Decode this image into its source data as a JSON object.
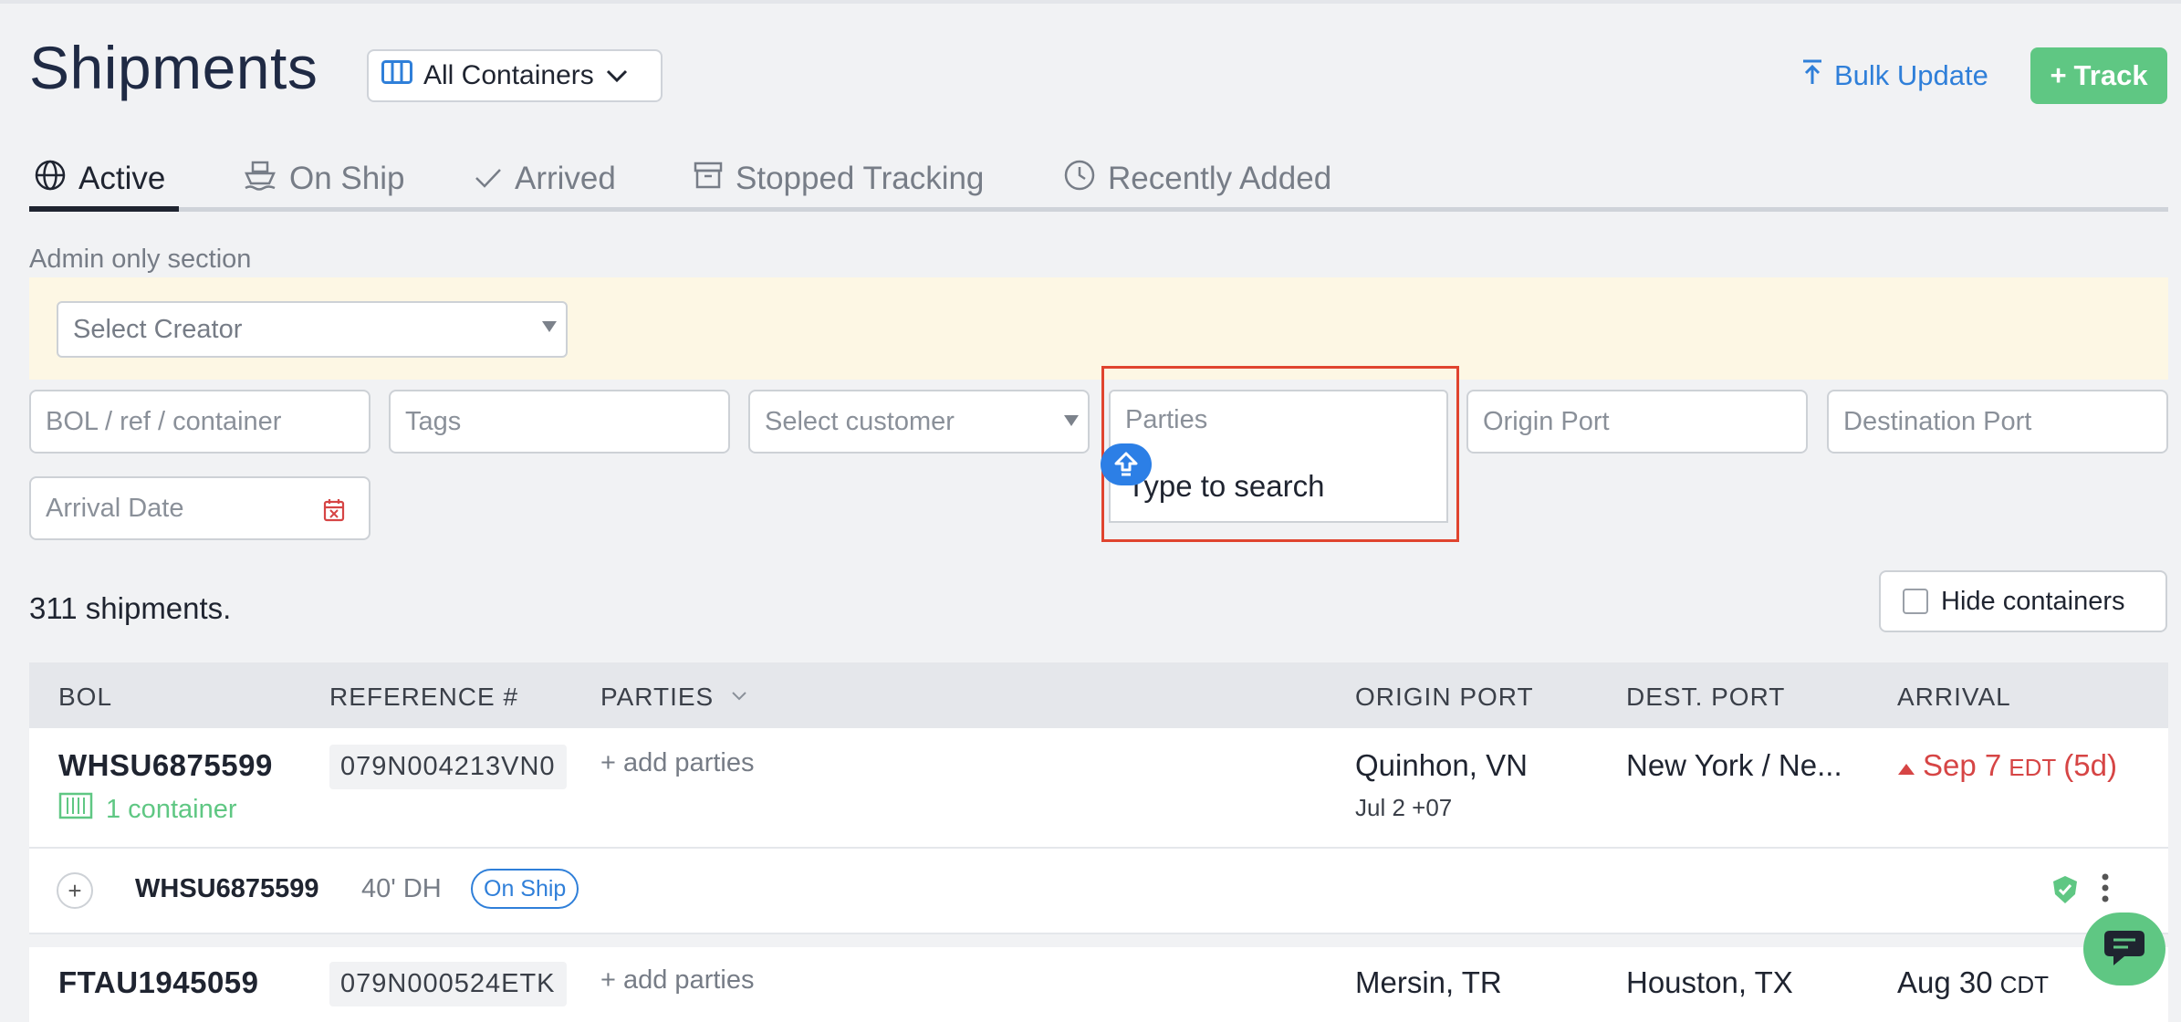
{
  "header": {
    "title": "Shipments",
    "view_select": "All Containers",
    "bulk_update": "Bulk Update",
    "track": "Track"
  },
  "tabs": [
    {
      "label": "Active",
      "icon": "globe-icon"
    },
    {
      "label": "On Ship",
      "icon": "ship-icon"
    },
    {
      "label": "Arrived",
      "icon": "check-icon"
    },
    {
      "label": "Stopped Tracking",
      "icon": "archive-icon"
    },
    {
      "label": "Recently Added",
      "icon": "clock-icon"
    }
  ],
  "admin": {
    "label": "Admin only section",
    "creator_placeholder": "Select Creator"
  },
  "filters": {
    "bol_placeholder": "BOL / ref / container",
    "tags_placeholder": "Tags",
    "customer_placeholder": "Select customer",
    "parties_placeholder": "Parties",
    "parties_dropdown_hint": "Type to search",
    "origin_placeholder": "Origin Port",
    "destination_placeholder": "Destination Port",
    "arrival_placeholder": "Arrival Date"
  },
  "summary": {
    "count_text": "311 shipments.",
    "hide_containers": "Hide containers"
  },
  "table": {
    "headers": [
      "BOL",
      "REFERENCE #",
      "PARTIES",
      "ORIGIN PORT",
      "DEST. PORT",
      "ARRIVAL"
    ],
    "rows": [
      {
        "bol": "WHSU6875599",
        "containers": "1 container",
        "reference": "079N004213VN0",
        "parties": "+ add parties",
        "origin": "Quinhon, VN",
        "origin_date": "Jul 2 +07",
        "destination": "New York / Ne...",
        "arrival": "Sep 7",
        "arrival_tz": "EDT",
        "arrival_delay": "(5d)"
      },
      {
        "bol": "FTAU1945059",
        "reference": "079N000524ETK",
        "parties": "+ add parties",
        "origin": "Mersin, TR",
        "destination": "Houston, TX",
        "arrival": "Aug 30",
        "arrival_tz": "CDT"
      }
    ],
    "sub_row": {
      "container": "WHSU6875599",
      "size": "40' DH",
      "status": "On Ship"
    }
  },
  "colors": {
    "accent_green": "#5fc783",
    "link_blue": "#2f7fd9",
    "alert_red": "#d64545",
    "highlight": "#e0442f"
  }
}
